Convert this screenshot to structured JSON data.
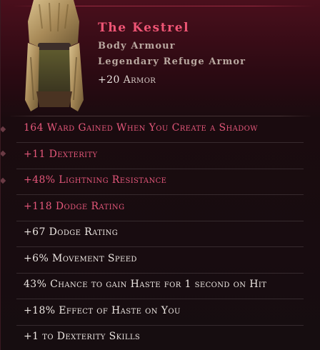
{
  "item": {
    "name": "The Kestrel",
    "type": "Body Armour",
    "rarity_line": "Legendary Refuge Armor",
    "armor_value": "+20",
    "armor_label": "Armor",
    "icon": "fur-cloak-armor-icon"
  },
  "colors": {
    "title": "#ef5575",
    "legendary_mod": "#e4577a",
    "normal_mod": "#ece6e2",
    "subtitle": "#b9a8a0",
    "header_bg": "#4a0f1c"
  },
  "modifiers": [
    {
      "text": "164 Ward Gained When You Create a Shadow",
      "kind": "legendary"
    },
    {
      "text": "+11 Dexterity",
      "kind": "legendary"
    },
    {
      "text": "+48% Lightning Resistance",
      "kind": "legendary"
    },
    {
      "text": "+118 Dodge Rating",
      "kind": "legendary"
    },
    {
      "text": "+67 Dodge Rating",
      "kind": "normal"
    },
    {
      "text": "+6% Movement Speed",
      "kind": "normal"
    },
    {
      "text": "43% Chance to gain Haste for 1 second on Hit",
      "kind": "normal"
    },
    {
      "text": "+18% Effect of Haste on You",
      "kind": "normal"
    },
    {
      "text": "+1 to Dexterity Skills",
      "kind": "normal"
    }
  ]
}
